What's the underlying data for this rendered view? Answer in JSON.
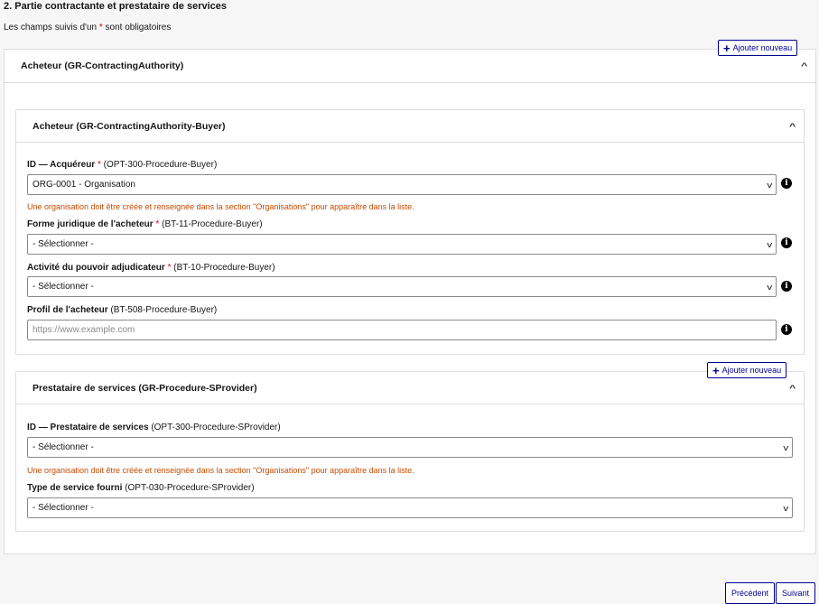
{
  "page": {
    "section_title": "2. Partie contractante et prestataire de services",
    "required_note_prefix": "Les champs suivis d'un",
    "required_note_star": "*",
    "required_note_suffix": "sont obligatoires"
  },
  "add_button_label": "Ajouter nouveau",
  "contracting_authority": {
    "title": "Acheteur (GR-ContractingAuthority)",
    "buyer": {
      "title": "Acheteur (GR-ContractingAuthority-Buyer)",
      "fields": {
        "acquirer": {
          "label": "ID — Acquéreur",
          "code": "(OPT-300-Procedure-Buyer)",
          "value": "ORG-0001 - Organisation",
          "warning": "Une organisation doit être créée et renseignée dans la section \"Organisations\" pour apparaître dans la liste."
        },
        "legal_form": {
          "label": "Forme juridique de l'acheteur",
          "code": "(BT-11-Procedure-Buyer)",
          "value": "- Sélectionner -"
        },
        "activity": {
          "label": "Activité du pouvoir adjudicateur",
          "code": "(BT-10-Procedure-Buyer)",
          "value": "- Sélectionner -"
        },
        "profile": {
          "label": "Profil de l'acheteur",
          "code": "(BT-508-Procedure-Buyer)",
          "placeholder": "https://www.example.com"
        }
      }
    }
  },
  "service_provider": {
    "title": "Prestataire de services (GR-Procedure-SProvider)",
    "fields": {
      "provider_id": {
        "label": "ID — Prestataire de services",
        "code": "(OPT-300-Procedure-SProvider)",
        "value": "- Sélectionner -",
        "warning": "Une organisation doit être créée et renseignée dans la section \"Organisations\" pour apparaître dans la liste."
      },
      "service_type": {
        "label": "Type de service fourni",
        "code": "(OPT-030-Procedure-SProvider)",
        "value": "- Sélectionner -"
      }
    }
  },
  "nav": {
    "previous": "Précédent",
    "next": "Suivant"
  },
  "icons": {
    "info": "info-icon",
    "plus": "plus-icon",
    "chevron_up": "chevron-up-icon",
    "chevron_down": "chevron-down-icon"
  },
  "colors": {
    "accent": "#000091",
    "required": "#e1000f",
    "warning": "#c44a00"
  }
}
